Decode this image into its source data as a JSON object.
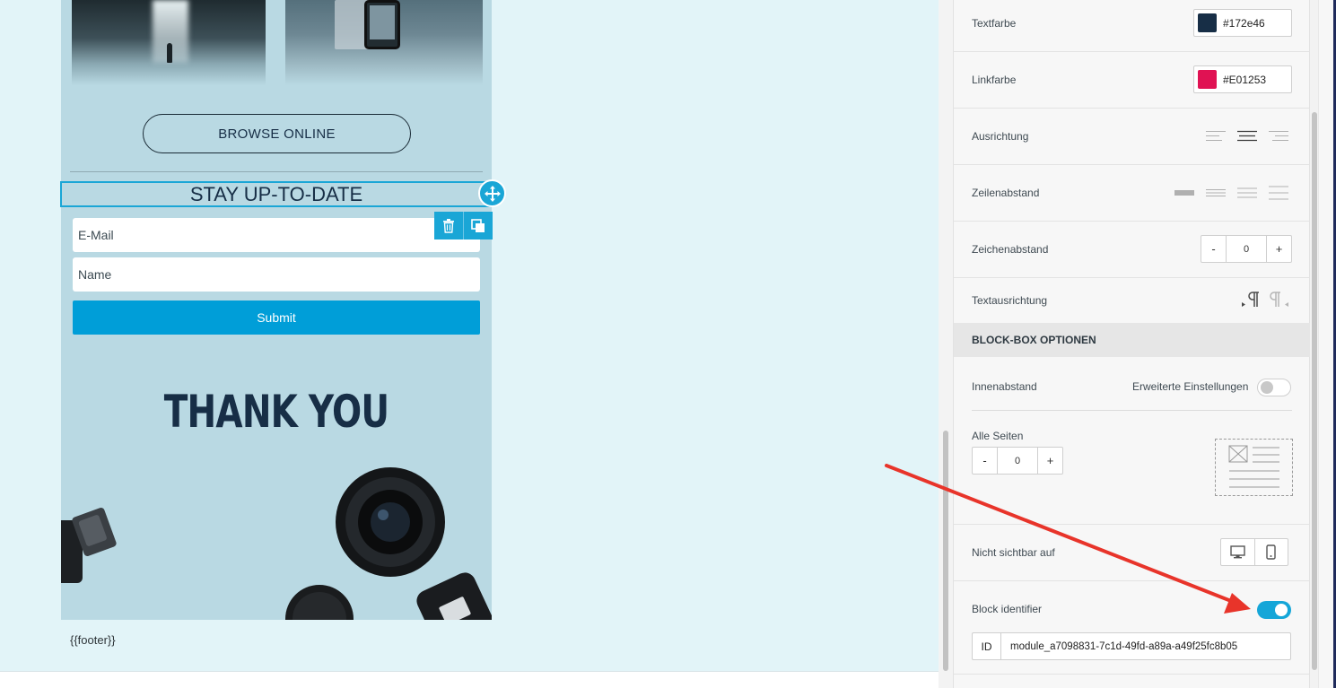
{
  "email": {
    "browse_button": "BROWSE ONLINE",
    "heading": "STAY UP-TO-DATE",
    "email_placeholder": "E-Mail",
    "name_placeholder": "Name",
    "submit_label": "Submit",
    "thank_you": "THANK YOU",
    "footer": "{{footer}}"
  },
  "panel": {
    "text_color": {
      "label": "Textfarbe",
      "value": "#172e46"
    },
    "link_color": {
      "label": "Linkfarbe",
      "value": "#E01253"
    },
    "alignment": {
      "label": "Ausrichtung",
      "options": [
        "left",
        "center",
        "right"
      ],
      "selected": "center"
    },
    "line_height": {
      "label": "Zeilenabstand"
    },
    "letter_spacing": {
      "label": "Zeichenabstand",
      "minus": "-",
      "value": "0",
      "plus": "+"
    },
    "text_direction": {
      "label": "Textausrichtung"
    },
    "block_box_header": "BLOCK-BOX OPTIONEN",
    "padding": {
      "label": "Innenabstand",
      "advanced_label": "Erweiterte Einstellungen",
      "advanced_enabled": false,
      "all_sides_label": "Alle Seiten",
      "minus": "-",
      "value": "0",
      "plus": "+"
    },
    "hidden_on": {
      "label": "Nicht sichtbar auf",
      "devices": [
        "desktop",
        "mobile"
      ]
    },
    "block_identifier": {
      "label": "Block identifier",
      "enabled": true,
      "id_prefix": "ID",
      "id_value": "module_a7098831-7c1d-49fd-a89a-a49f25fc8b05"
    }
  },
  "colors": {
    "accent": "#1aa6d6",
    "text_color": "#172e46",
    "link_color": "#E01253",
    "email_bg": "#b9d9e3",
    "canvas_bg": "#e2f4f8",
    "annotation_arrow": "#e8342a"
  }
}
